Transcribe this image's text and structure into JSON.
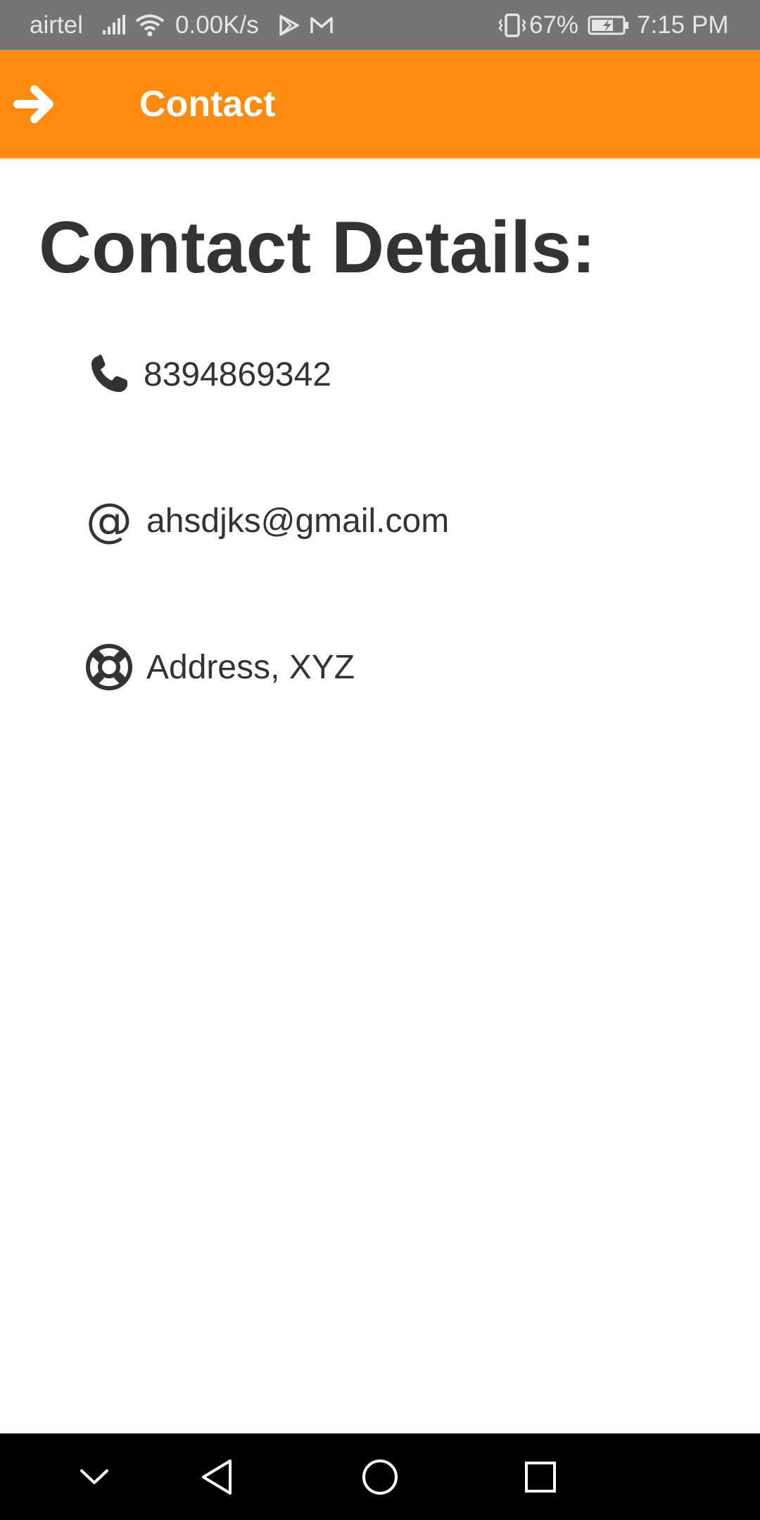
{
  "status_bar": {
    "carrier": "airtel",
    "speed": "0.00K/s",
    "battery": "67%",
    "time": "7:15 PM",
    "icons": [
      "signal-icon",
      "wifi-icon",
      "play-store-icon",
      "gmail-icon",
      "vibrate-icon",
      "battery-charging-icon"
    ]
  },
  "app_bar": {
    "title": "Contact",
    "background_color": "#ff8a10",
    "back_icon": "arrow-right-icon"
  },
  "content": {
    "heading": "Contact Details:",
    "items": [
      {
        "icon": "phone-icon",
        "text": "8394869342"
      },
      {
        "icon": "at-icon",
        "text": "ahsdjks@gmail.com"
      },
      {
        "icon": "lifebuoy-icon",
        "text": "Address, XYZ"
      }
    ]
  },
  "nav_bar": {
    "buttons": [
      "chevron-down-icon",
      "back-triangle-icon",
      "home-circle-icon",
      "recents-square-icon"
    ]
  }
}
